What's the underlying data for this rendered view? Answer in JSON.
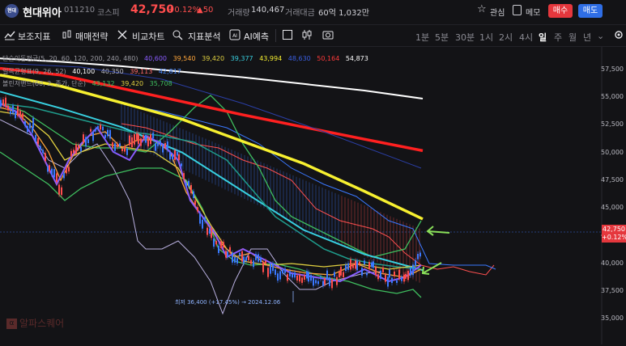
{
  "header": {
    "logo_text": "현대",
    "name": "현대위아",
    "code": "011210",
    "market": "코스피",
    "price": "42,750",
    "change_pct": "+0.12%",
    "change_abs": "▲50",
    "volume_label": "거래량",
    "volume_value": "140,467",
    "amount_label": "거래대금",
    "amount_value": "60억 1,032만",
    "fav_label": "관심",
    "memo_label": "메모",
    "buy_label": "매수",
    "sell_label": "매도"
  },
  "toolbar": {
    "indicator": "보조지표",
    "strategy": "매매전략",
    "compare": "비교차트",
    "indicator_analysis": "지표분석",
    "ai": "AI예측",
    "periods": [
      "1분",
      "5분",
      "30분",
      "1시",
      "2시",
      "4시",
      "일",
      "주",
      "월",
      "년"
    ],
    "active_period": "일"
  },
  "legend": {
    "ma_label": "단순이동평균",
    "ma_params": "(5, 20, 60, 120, 200, 240, 480)",
    "ma_values": [
      {
        "v": "40,600",
        "color": "#8a5cff"
      },
      {
        "v": "39,540",
        "color": "#ffa63a"
      },
      {
        "v": "39,420",
        "color": "#e0d040"
      },
      {
        "v": "39,377",
        "color": "#38d0e0"
      },
      {
        "v": "43,994",
        "color": "#f7f030"
      },
      {
        "v": "48,630",
        "color": "#3a5ee0"
      },
      {
        "v": "50,164",
        "color": "#ff3a3a"
      },
      {
        "v": "54,873",
        "color": "#ffffff"
      }
    ],
    "ichimoku_label": "일목균형표",
    "ichimoku_params": "(9, 26, 52)",
    "ichimoku_values": [
      {
        "v": "40,100",
        "color": "#ffffff"
      },
      {
        "v": "40,350",
        "color": "#b8b8c0"
      },
      {
        "v": "39,113",
        "color": "#ff6a6a"
      },
      {
        "v": "42,817",
        "color": "#4a8aff"
      }
    ],
    "bollinger_label": "볼린저밴드",
    "bollinger_params": "(60, 2, 종가, 단순)",
    "bollinger_values": [
      {
        "v": "43,132",
        "color": "#3fbf5f"
      },
      {
        "v": "39,420",
        "color": "#e0d040"
      },
      {
        "v": "35,708",
        "color": "#3fbf5f"
      }
    ]
  },
  "price_label": {
    "price": "42,750",
    "pct": "+0.12%"
  },
  "low_annotation": "최저 36,400 (+17.45%) → 2024.12.06",
  "watermark": "알파스퀘어",
  "watermark_icon": "α",
  "chart_data": {
    "type": "line",
    "ylim": [
      35000,
      58500
    ],
    "yticks": [
      "57,500",
      "55,000",
      "52,500",
      "50,000",
      "47,500",
      "45,000",
      "42,500",
      "40,000",
      "37,500",
      "35,000"
    ],
    "current_price": 42750,
    "low": {
      "value": 36400,
      "date": "2024.12.06"
    },
    "series": [
      {
        "name": "단순이동평균 480",
        "color": "#ffffff",
        "values": [
          58500,
          58200,
          57800,
          57300,
          56800,
          56200,
          55600,
          54873
        ]
      },
      {
        "name": "단순이동평균 240",
        "color": "#ff2020",
        "values": [
          57600,
          57000,
          55800,
          54600,
          53400,
          52300,
          51200,
          50164
        ]
      },
      {
        "name": "단순이동평균 200",
        "color": "#f7f030",
        "values": [
          57000,
          56000,
          54500,
          53000,
          51000,
          49000,
          46500,
          43994
        ]
      },
      {
        "name": "단순이동평균 120",
        "color": "#38d0e0",
        "values": [
          55500,
          54000,
          52300,
          50000,
          46500,
          43000,
          40800,
          39377
        ]
      }
    ]
  }
}
